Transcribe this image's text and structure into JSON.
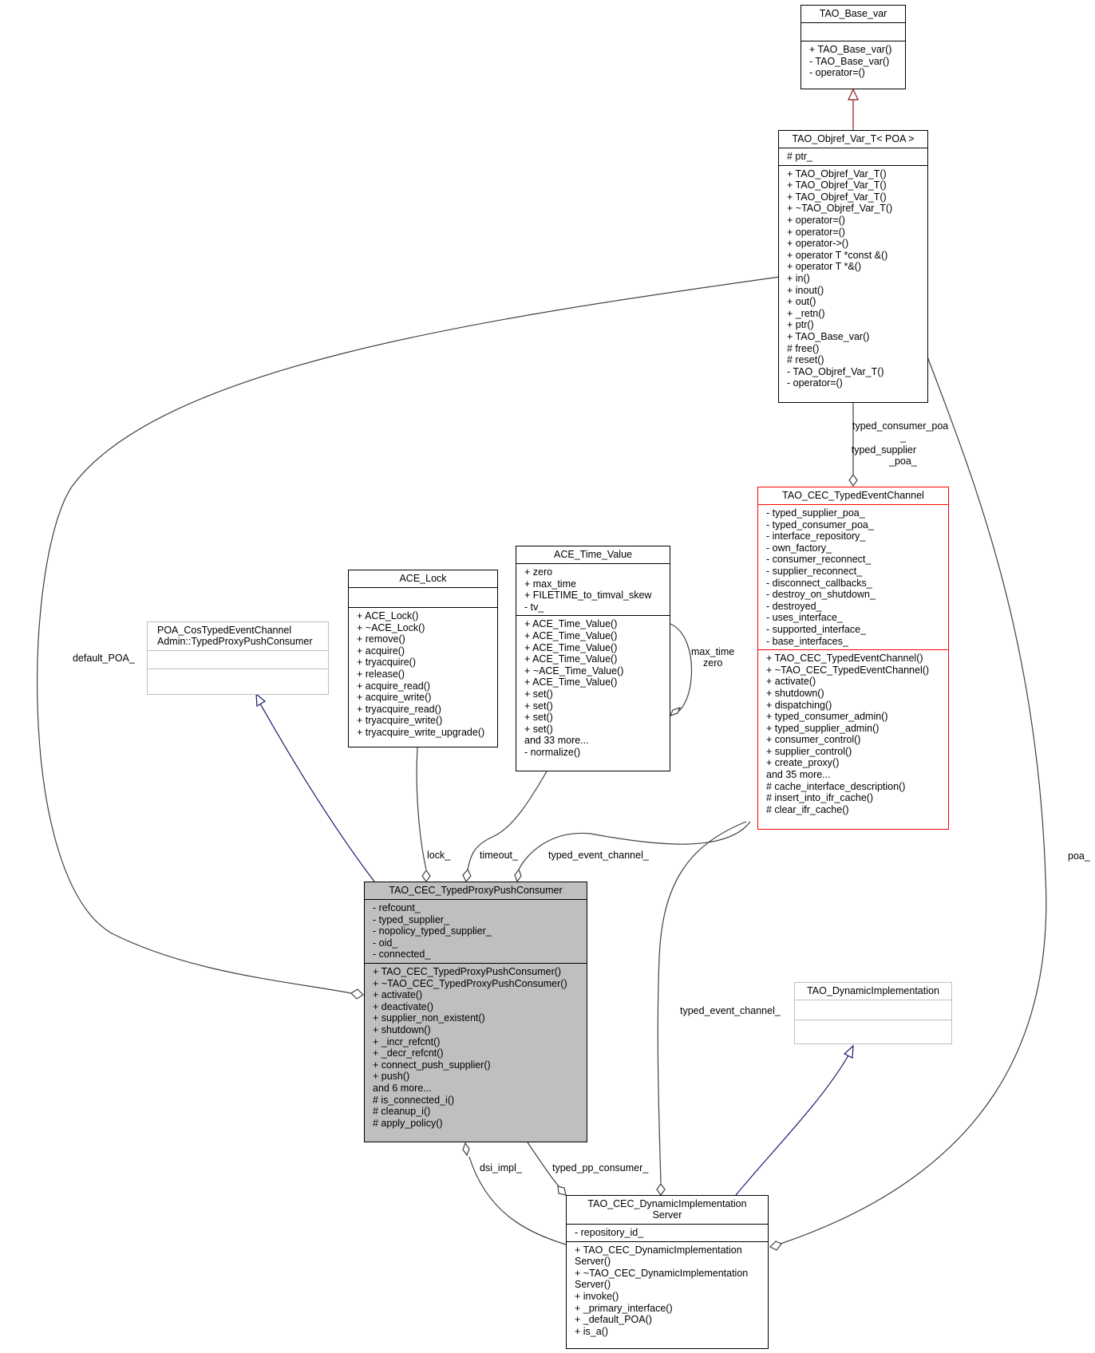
{
  "diagram": {
    "type": "doxygen-collaboration-graph",
    "classes": {
      "tao_base_var": {
        "name": "TAO_Base_var",
        "attributes": [],
        "methods": [
          "+ TAO_Base_var()",
          "- TAO_Base_var()",
          "- operator=()"
        ]
      },
      "tao_objref_var_t": {
        "name": "TAO_Objref_Var_T< POA >",
        "attributes": [
          "# ptr_"
        ],
        "methods": [
          "+ TAO_Objref_Var_T()",
          "+ TAO_Objref_Var_T()",
          "+ TAO_Objref_Var_T()",
          "+ ~TAO_Objref_Var_T()",
          "+ operator=()",
          "+ operator=()",
          "+ operator->()",
          "+ operator T *const &()",
          "+ operator T *&()",
          "+ in()",
          "+ inout()",
          "+ out()",
          "+ _retn()",
          "+ ptr()",
          "+ TAO_Base_var()",
          "# free()",
          "# reset()",
          "- TAO_Objref_Var_T()",
          "- operator=()"
        ]
      },
      "tao_cec_typed_event_channel": {
        "name": "TAO_CEC_TypedEventChannel",
        "attributes": [
          "- typed_supplier_poa_",
          "- typed_consumer_poa_",
          "- interface_repository_",
          "- own_factory_",
          "- consumer_reconnect_",
          "- supplier_reconnect_",
          "- disconnect_callbacks_",
          "- destroy_on_shutdown_",
          "- destroyed_",
          "- uses_interface_",
          "- supported_interface_",
          "- base_interfaces_"
        ],
        "methods": [
          "+ TAO_CEC_TypedEventChannel()",
          "+ ~TAO_CEC_TypedEventChannel()",
          "+ activate()",
          "+ shutdown()",
          "+ dispatching()",
          "+ typed_consumer_admin()",
          "+ typed_supplier_admin()",
          "+ consumer_control()",
          "+ supplier_control()",
          "+ create_proxy()",
          "and 35 more...",
          "# cache_interface_description()",
          "# insert_into_ifr_cache()",
          "# clear_ifr_cache()"
        ]
      },
      "ace_time_value": {
        "name": "ACE_Time_Value",
        "attributes": [
          "+ zero",
          "+ max_time",
          "+ FILETIME_to_timval_skew",
          "- tv_"
        ],
        "methods": [
          "+ ACE_Time_Value()",
          "+ ACE_Time_Value()",
          "+ ACE_Time_Value()",
          "+ ACE_Time_Value()",
          "+ ~ACE_Time_Value()",
          "+ ACE_Time_Value()",
          "+ set()",
          "+ set()",
          "+ set()",
          "+ set()",
          "and 33 more...",
          "- normalize()"
        ]
      },
      "ace_lock": {
        "name": "ACE_Lock",
        "attributes": [],
        "methods": [
          "+ ACE_Lock()",
          "+ ~ACE_Lock()",
          "+ remove()",
          "+ acquire()",
          "+ tryacquire()",
          "+ release()",
          "+ acquire_read()",
          "+ acquire_write()",
          "+ tryacquire_read()",
          "+ tryacquire_write()",
          "+ tryacquire_write_upgrade()"
        ]
      },
      "poa_typed_proxy_push_consumer": {
        "name_line1": "POA_CosTypedEventChannel",
        "name_line2": "Admin::TypedProxyPushConsumer",
        "attributes": [],
        "methods": []
      },
      "tao_cec_typed_proxy_push_consumer": {
        "name": "TAO_CEC_TypedProxyPushConsumer",
        "attributes": [
          "- refcount_",
          "- typed_supplier_",
          "- nopolicy_typed_supplier_",
          "- oid_",
          "- connected_"
        ],
        "methods": [
          "+ TAO_CEC_TypedProxyPushConsumer()",
          "+ ~TAO_CEC_TypedProxyPushConsumer()",
          "+ activate()",
          "+ deactivate()",
          "+ supplier_non_existent()",
          "+ shutdown()",
          "+ _incr_refcnt()",
          "+ _decr_refcnt()",
          "+ connect_push_supplier()",
          "+ push()",
          "and 6 more...",
          "# is_connected_i()",
          "# cleanup_i()",
          "# apply_policy()"
        ]
      },
      "tao_dynamic_implementation": {
        "name": "TAO_DynamicImplementation",
        "attributes": [],
        "methods": []
      },
      "tao_cec_dynamic_implementation_server": {
        "name_line1": "TAO_CEC_DynamicImplementation",
        "name_line2": "Server",
        "attributes": [
          "- repository_id_"
        ],
        "methods": [
          "+ TAO_CEC_DynamicImplementation",
          "Server()",
          "+ ~TAO_CEC_DynamicImplementation",
          "Server()",
          "+ invoke()",
          "+ _primary_interface()",
          "+ _default_POA()",
          "+ is_a()"
        ]
      }
    },
    "edge_labels": {
      "typed_poa_line1": "typed_consumer_poa",
      "typed_poa_line2": "_",
      "typed_poa_line3": "typed_supplier",
      "typed_poa_line4": "_poa_",
      "max_time_zero_line1": "max_time",
      "max_time_zero_line2": "zero",
      "default_poa": "default_POA_",
      "lock": "lock_",
      "timeout": "timeout_",
      "typed_event_channel_top": "typed_event_channel_",
      "typed_event_channel_side": "typed_event_channel_",
      "poa": "poa_",
      "dsi_impl": "dsi_impl_",
      "typed_pp_consumer": "typed_pp_consumer_"
    },
    "colors": {
      "inheritance_public": "#191970",
      "inheritance_template": "#8b1a1a",
      "usage": "#404040",
      "focus_fill": "#bfbfbf",
      "undocumented_border": "#bfbfbf",
      "truncated_border": "#ff0000"
    }
  }
}
